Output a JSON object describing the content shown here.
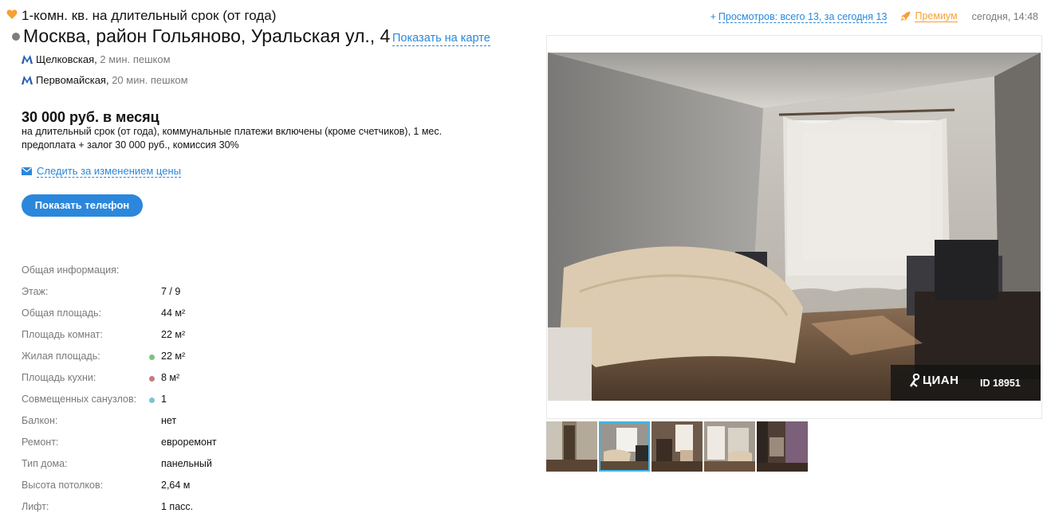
{
  "header": {
    "title": "1-комн. кв. на длительный срок (от года)",
    "views_prefix": "+",
    "views": "Просмотров: всего 13, за сегодня 13",
    "premium": "Премиум",
    "date": "сегодня, 14:48"
  },
  "address": {
    "text": "Москва, район Гольяново, Уральская ул., 4",
    "map_link": "Показать на карте"
  },
  "metro": [
    {
      "station": "Щелковская,",
      "walk": "2 мин. пешком"
    },
    {
      "station": "Первомайская,",
      "walk": "20 мин. пешком"
    }
  ],
  "price": {
    "amount": "30 000 руб. в месяц",
    "terms": "на длительный срок (от года), коммунальные платежи включены (кроме счетчиков), 1 мес. предоплата + залог 30 000 руб., комиссия 30%"
  },
  "actions": {
    "watch_price": "Следить за изменением цены",
    "show_phone": "Показать телефон"
  },
  "info": {
    "heading": "Общая информация:",
    "rows": [
      {
        "label": "Этаж:",
        "value": "7 / 9"
      },
      {
        "label": "Общая площадь:",
        "value": "44 м²"
      },
      {
        "label": "Площадь комнат:",
        "value": "22 м²"
      },
      {
        "label": "Жилая площадь:",
        "value": "22 м²"
      },
      {
        "label": "Площадь кухни:",
        "value": "8 м²"
      },
      {
        "label": "Совмещенных санузлов:",
        "value": "1"
      },
      {
        "label": "Балкон:",
        "value": "нет"
      },
      {
        "label": "Ремонт:",
        "value": "евроремонт"
      },
      {
        "label": "Тип дома:",
        "value": "панельный"
      },
      {
        "label": "Высота потолков:",
        "value": "2,64 м"
      },
      {
        "label": "Лифт:",
        "value": "1 пасс."
      }
    ]
  },
  "gallery": {
    "logo_text": "ЦИАН",
    "photo_id": "ID 18951",
    "active_thumb": 2
  },
  "colors": {
    "accent": "#2b87db",
    "premium": "#f7a033",
    "living_dot": "#7bc47f",
    "kitchen_dot": "#c97a7a",
    "bath_dot": "#7ec3cf"
  },
  "icons": [
    "heart-icon",
    "rocket-icon",
    "metro-icon",
    "mail-icon",
    "cian-pin-icon"
  ]
}
